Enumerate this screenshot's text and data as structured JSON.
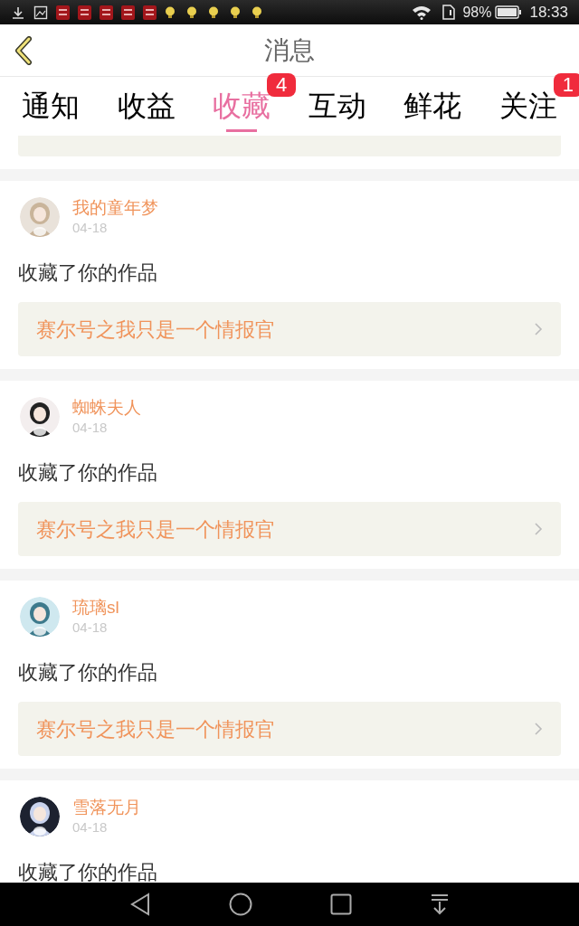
{
  "status_bar": {
    "battery_percent": "98%",
    "time": "18:33"
  },
  "header": {
    "title": "消息"
  },
  "tabs": [
    {
      "label": "通知",
      "selected": false
    },
    {
      "label": "收益",
      "selected": false
    },
    {
      "label": "收藏",
      "selected": true,
      "badge": "4"
    },
    {
      "label": "互动",
      "selected": false
    },
    {
      "label": "鲜花",
      "selected": false
    },
    {
      "label": "关注",
      "selected": false,
      "badge": "1"
    }
  ],
  "messages": [
    {
      "user": "我的童年梦",
      "date": "04-18",
      "text": "收藏了你的作品",
      "work": "赛尔号之我只是一个情报官"
    },
    {
      "user": "蜘蛛夫人",
      "date": "04-18",
      "text": "收藏了你的作品",
      "work": "赛尔号之我只是一个情报官"
    },
    {
      "user": "琉璃sl",
      "date": "04-18",
      "text": "收藏了你的作品",
      "work": "赛尔号之我只是一个情报官"
    },
    {
      "user": "雪落无月",
      "date": "04-18",
      "text": "收藏了你的作品"
    }
  ]
}
